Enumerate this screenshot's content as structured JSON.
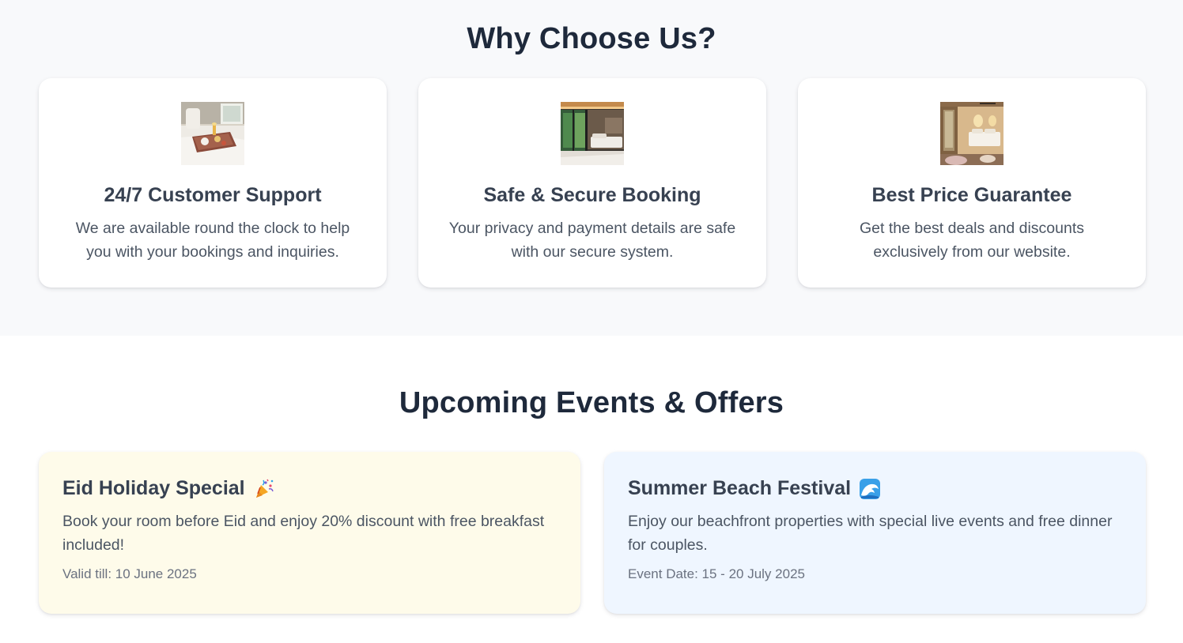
{
  "why_section": {
    "title": "Why Choose Us?",
    "features": [
      {
        "image": "breakfast-tray-in-bed-photo",
        "title": "24/7 Customer Support",
        "description": "We are available round the clock to help you with your bookings and inquiries."
      },
      {
        "image": "modern-bedroom-garden-view-photo",
        "title": "Safe & Secure Booking",
        "description": "Your privacy and payment details are safe with our secure system."
      },
      {
        "image": "luxury-hotel-room-photo",
        "title": "Best Price Guarantee",
        "description": "Get the best deals and discounts exclusively from our website."
      }
    ]
  },
  "events_section": {
    "title": "Upcoming Events & Offers",
    "offers": [
      {
        "title": "Eid Holiday Special",
        "icon": "party-popper-icon",
        "description": "Book your room before Eid and enjoy 20% discount with free breakfast included!",
        "meta": "Valid till: 10 June 2025",
        "background": "#fefbea"
      },
      {
        "title": "Summer Beach Festival",
        "icon": "wave-icon",
        "description": "Enjoy our beachfront properties with special live events and free dinner for couples.",
        "meta": "Event Date: 15 - 20 July 2025",
        "background": "#eff6ff"
      }
    ]
  }
}
